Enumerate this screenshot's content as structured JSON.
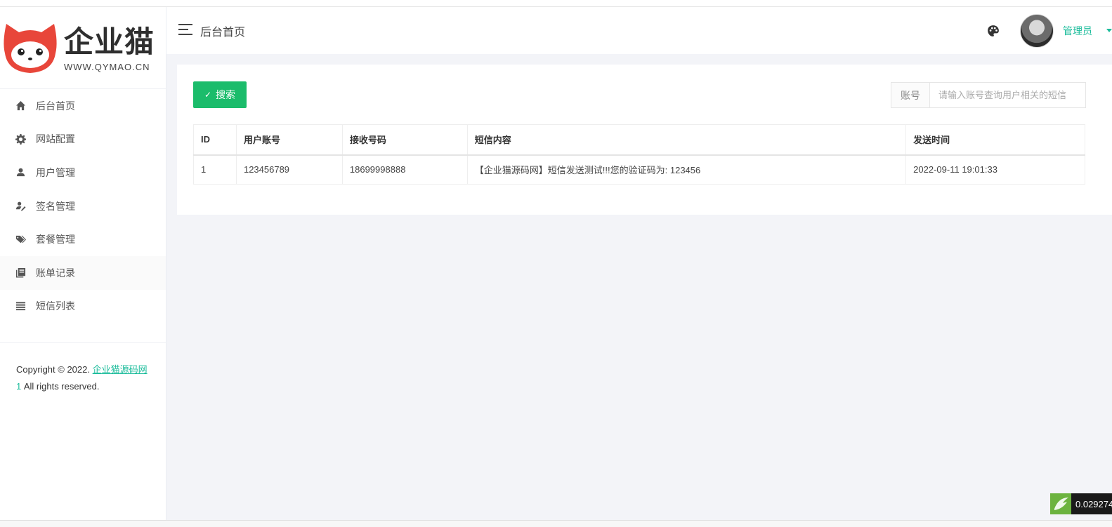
{
  "brand": {
    "name": "企业猫",
    "url_text": "WWW.QYMAO.CN",
    "accent_color": "#1bbc9b",
    "logo_red": "#e8463a"
  },
  "sidebar": {
    "items": [
      {
        "label": "后台首页",
        "icon": "home-icon"
      },
      {
        "label": "网站配置",
        "icon": "gear-icon"
      },
      {
        "label": "用户管理",
        "icon": "user-icon"
      },
      {
        "label": "签名管理",
        "icon": "signature-icon"
      },
      {
        "label": "套餐管理",
        "icon": "tags-icon"
      },
      {
        "label": "账单记录",
        "icon": "book-icon"
      },
      {
        "label": "短信列表",
        "icon": "list-icon"
      }
    ],
    "copyright_prefix": "Copyright © 2022.",
    "copyright_link": "企业猫源码网",
    "copyright_num": "1",
    "copyright_suffix": " All rights reserved."
  },
  "header": {
    "title": "后台首页",
    "user_name": "管理员"
  },
  "toolbar": {
    "search_label": "搜索",
    "account_label": "账号",
    "account_placeholder": "请输入账号查询用户相关的短信"
  },
  "table": {
    "columns": [
      "ID",
      "用户账号",
      "接收号码",
      "短信内容",
      "发送时间"
    ],
    "rows": [
      [
        "1",
        "123456789",
        "18699998888",
        "【企业猫源码网】短信发送测试!!!您的验证码为: 123456",
        "2022-09-11 19:01:33"
      ]
    ]
  },
  "overlay": {
    "timer_text": "0.029274"
  }
}
